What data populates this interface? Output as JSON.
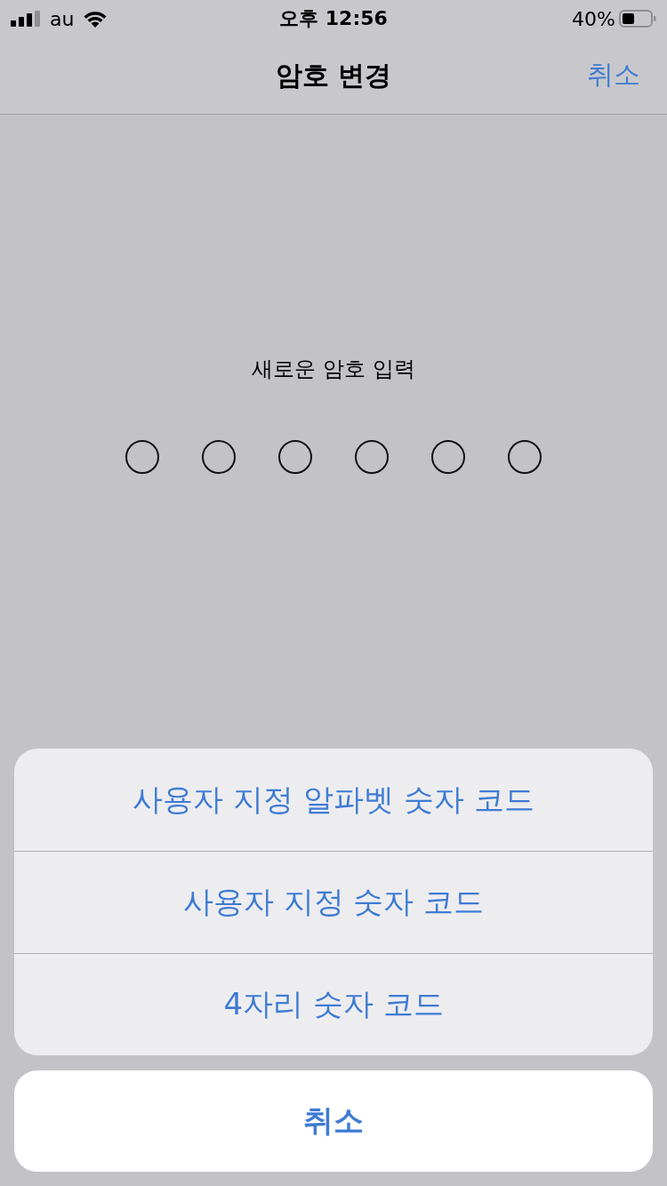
{
  "status_bar": {
    "carrier": "au",
    "time": "오후 12:56",
    "battery": "40%"
  },
  "nav_bar": {
    "title": "암호 변경",
    "cancel": "취소"
  },
  "passcode": {
    "prompt": "새로운 암호 입력",
    "dots": [
      {
        "filled": false
      },
      {
        "filled": false
      },
      {
        "filled": false
      },
      {
        "filled": false
      },
      {
        "filled": false
      },
      {
        "filled": false
      }
    ]
  },
  "action_sheet": {
    "options": [
      "사용자 지정 알파벳 숫자 코드",
      "사용자 지정 숫자 코드",
      "4자리 숫자 코드"
    ],
    "cancel": "취소"
  }
}
